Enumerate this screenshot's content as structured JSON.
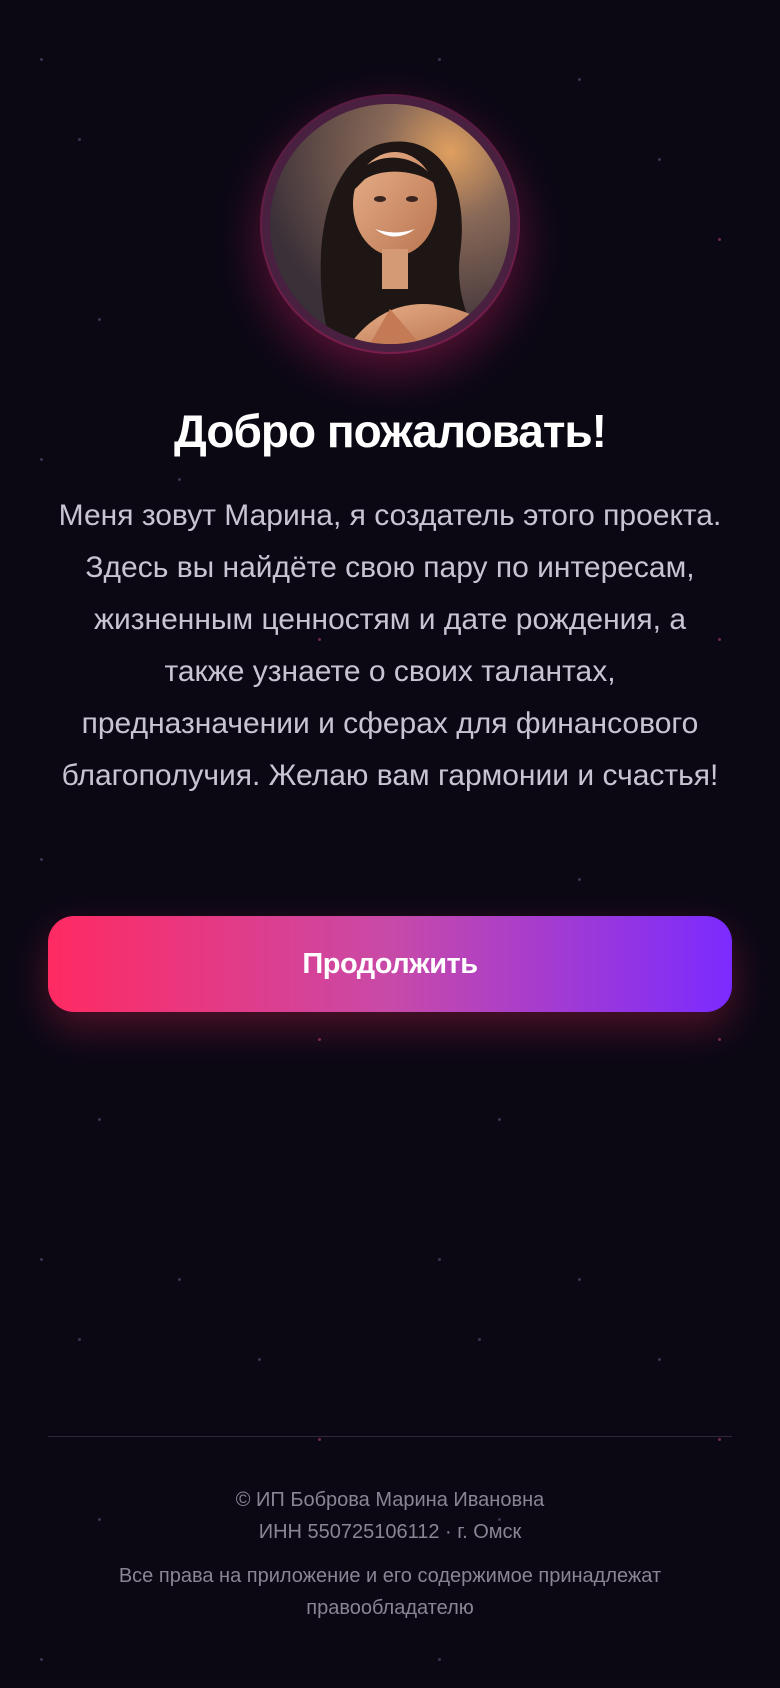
{
  "avatar": {
    "alt": "Марина"
  },
  "welcome": {
    "title": "Добро пожаловать!",
    "text": "Меня зовут Марина, я создатель этого проекта. Здесь вы найдёте свою пару по интересам, жизненным ценностям и дате рождения, а также узнаете о своих талантах, предназначении и сферах для финансового благополучия. Желаю вам гармонии и счастья!"
  },
  "actions": {
    "continue_label": "Продолжить"
  },
  "footer": {
    "owner": "© ИП Боброва Марина Ивановна",
    "inn": "ИНН 550725106112 · г. Омск",
    "rights_line1": "Все права на приложение и его содержимое принадлежат",
    "rights_line2": "правообладателю"
  },
  "colors": {
    "background": "#0b0814",
    "button_start": "#ff2a62",
    "button_end": "#7b2bff",
    "text_primary": "#ffffff",
    "text_secondary": "#c9c4d2",
    "text_muted": "#8a8595"
  }
}
